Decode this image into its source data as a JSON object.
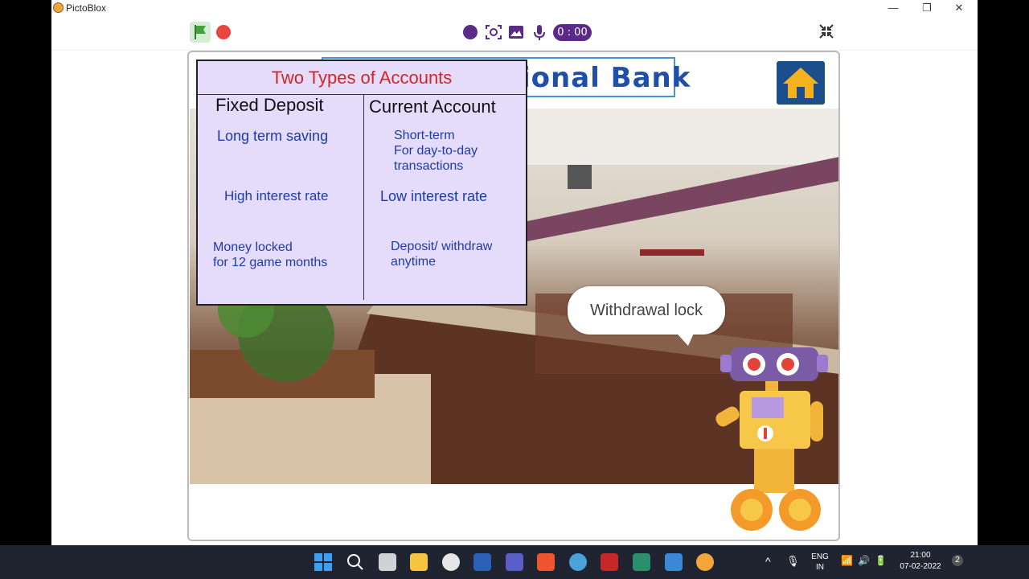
{
  "window": {
    "title": "PictoBlox",
    "controls": {
      "minimize": "—",
      "restore": "❐",
      "close": "✕"
    }
  },
  "toolbar": {
    "timer": "0 : 00",
    "icons": [
      "green-flag-icon",
      "stop-icon",
      "record-icon",
      "screenshot-icon",
      "image-icon",
      "microphone-icon",
      "fullscreen-icon"
    ]
  },
  "stage": {
    "bank_title": "ional Bank",
    "card": {
      "title": "Two Types of Accounts",
      "columns": [
        "Fixed Deposit",
        "Current Account"
      ],
      "rows": [
        [
          "Long term saving",
          "Short-term\nFor day-to-day\ntransactions"
        ],
        [
          "High interest rate",
          "Low interest rate"
        ],
        [
          "Money locked\nfor 12 game months",
          "Deposit/ withdraw\nanytime"
        ]
      ]
    },
    "speech_bubble": "Withdrawal lock"
  },
  "taskbar": {
    "lang": "ENG",
    "region": "IN",
    "time": "21:00",
    "date": "07-02-2022",
    "notifications": "2"
  },
  "colors": {
    "card_bg": "#e5dcfb",
    "card_title": "#d42424",
    "cell_text": "#1d3ab0",
    "timer_bg": "#5b2a86"
  }
}
